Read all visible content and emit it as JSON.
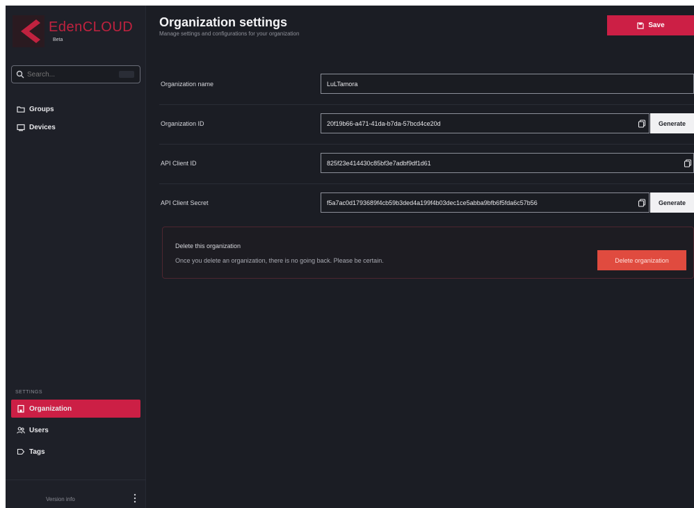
{
  "app": {
    "brand_name": "EdenCLOUD",
    "brand_sub": "Beta",
    "brand_color": "#c0223f",
    "accent_color": "#cc1f45",
    "danger_color": "#e04b3f"
  },
  "sidebar": {
    "search": {
      "placeholder": "Search...",
      "value": ""
    },
    "items": [
      {
        "label": "Groups",
        "icon": "folder-icon"
      },
      {
        "label": "Devices",
        "icon": "device-icon"
      }
    ],
    "section_label": "SETTINGS",
    "settings_items": [
      {
        "label": "Organization",
        "icon": "organization-icon",
        "active": true
      },
      {
        "label": "Users",
        "icon": "users-icon"
      },
      {
        "label": "Tags",
        "icon": "tag-icon"
      }
    ],
    "footer": {
      "version": "Version info"
    }
  },
  "header": {
    "title": "Organization settings",
    "subtitle": "Manage settings and configurations for your organization",
    "save_label": "Save"
  },
  "fields": {
    "org_name": {
      "label": "Organization name",
      "value": "LuLTamora"
    },
    "org_id": {
      "label": "Organization ID",
      "value": "20f19b66-a471-41da-b7da-57bcd4ce20d",
      "button": "Generate"
    },
    "api_client_id": {
      "label": "API Client ID",
      "value": "825f23e414430c85bf3e7adbf9df1d61"
    },
    "api_client_secret": {
      "label": "API Client Secret",
      "value": "f5a7ac0d1793689f4cb59b3ded4a199f4b03dec1ce5abba9bfb6f5fda6c57b56",
      "button": "Generate"
    }
  },
  "danger": {
    "title": "Delete this organization",
    "description": "Once you delete an organization, there is no going back. Please be certain.",
    "button": "Delete organization"
  }
}
